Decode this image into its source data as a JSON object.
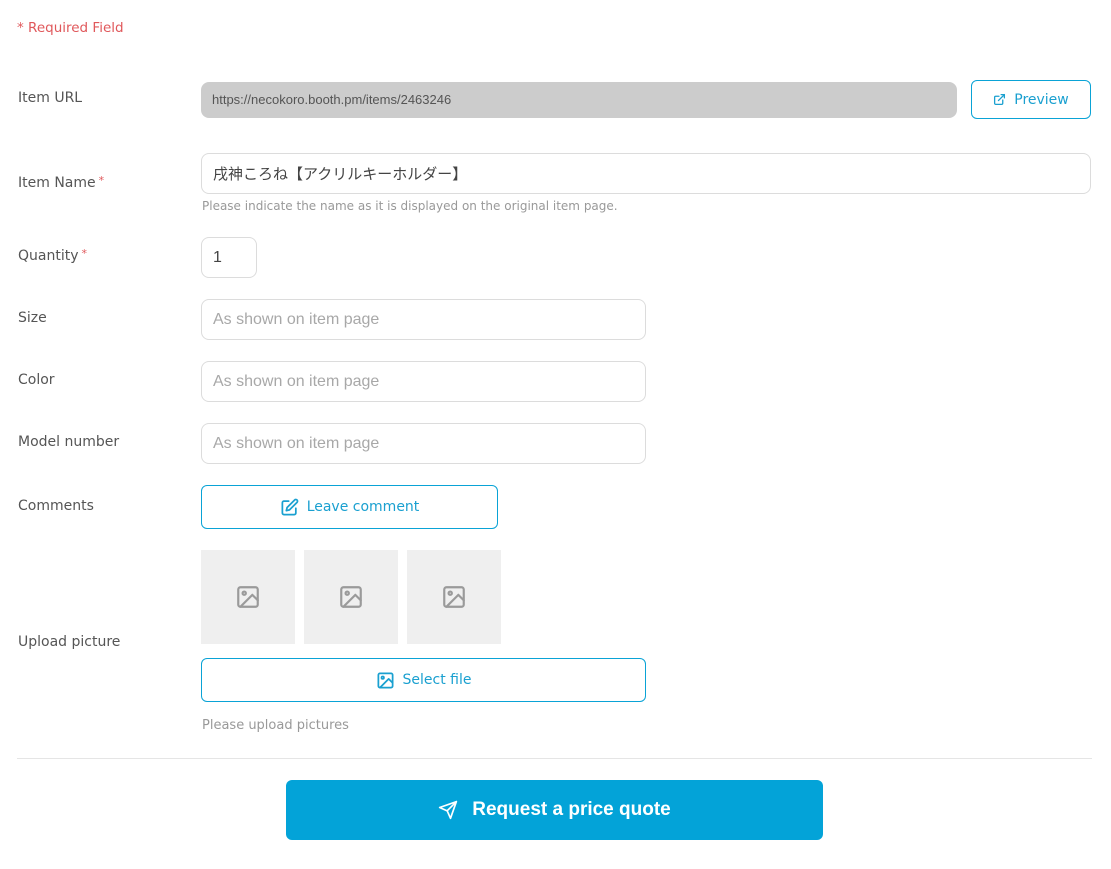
{
  "required_note": "* Required Field",
  "required_marker": "*",
  "colors": {
    "accent": "#03a3d8",
    "required": "#e0585b",
    "readonly_bg": "#cccccc"
  },
  "item_url": {
    "label": "Item URL",
    "value": "https://necokoro.booth.pm/items/2463246",
    "preview_label": "Preview",
    "preview_icon": "external-link-icon"
  },
  "item_name": {
    "label": "Item Name",
    "required": true,
    "value": "戌神ころね【アクリルキーホルダー】",
    "hint": "Please indicate the name as it is displayed on the original item page."
  },
  "quantity": {
    "label": "Quantity",
    "required": true,
    "value": "1"
  },
  "size": {
    "label": "Size",
    "value": "",
    "placeholder": "As shown on item page"
  },
  "color": {
    "label": "Color",
    "value": "",
    "placeholder": "As shown on item page"
  },
  "model_number": {
    "label": "Model number",
    "value": "",
    "placeholder": "As shown on item page"
  },
  "comments": {
    "label": "Comments",
    "button_label": "Leave comment",
    "button_icon": "edit-icon"
  },
  "upload": {
    "label": "Upload picture",
    "thumbnails": [
      {
        "icon": "image-placeholder-icon"
      },
      {
        "icon": "image-placeholder-icon"
      },
      {
        "icon": "image-placeholder-icon"
      }
    ],
    "select_label": "Select file",
    "select_icon": "image-icon",
    "hint": "Please upload pictures"
  },
  "submit": {
    "label": "Request a price quote",
    "icon": "send-icon"
  }
}
